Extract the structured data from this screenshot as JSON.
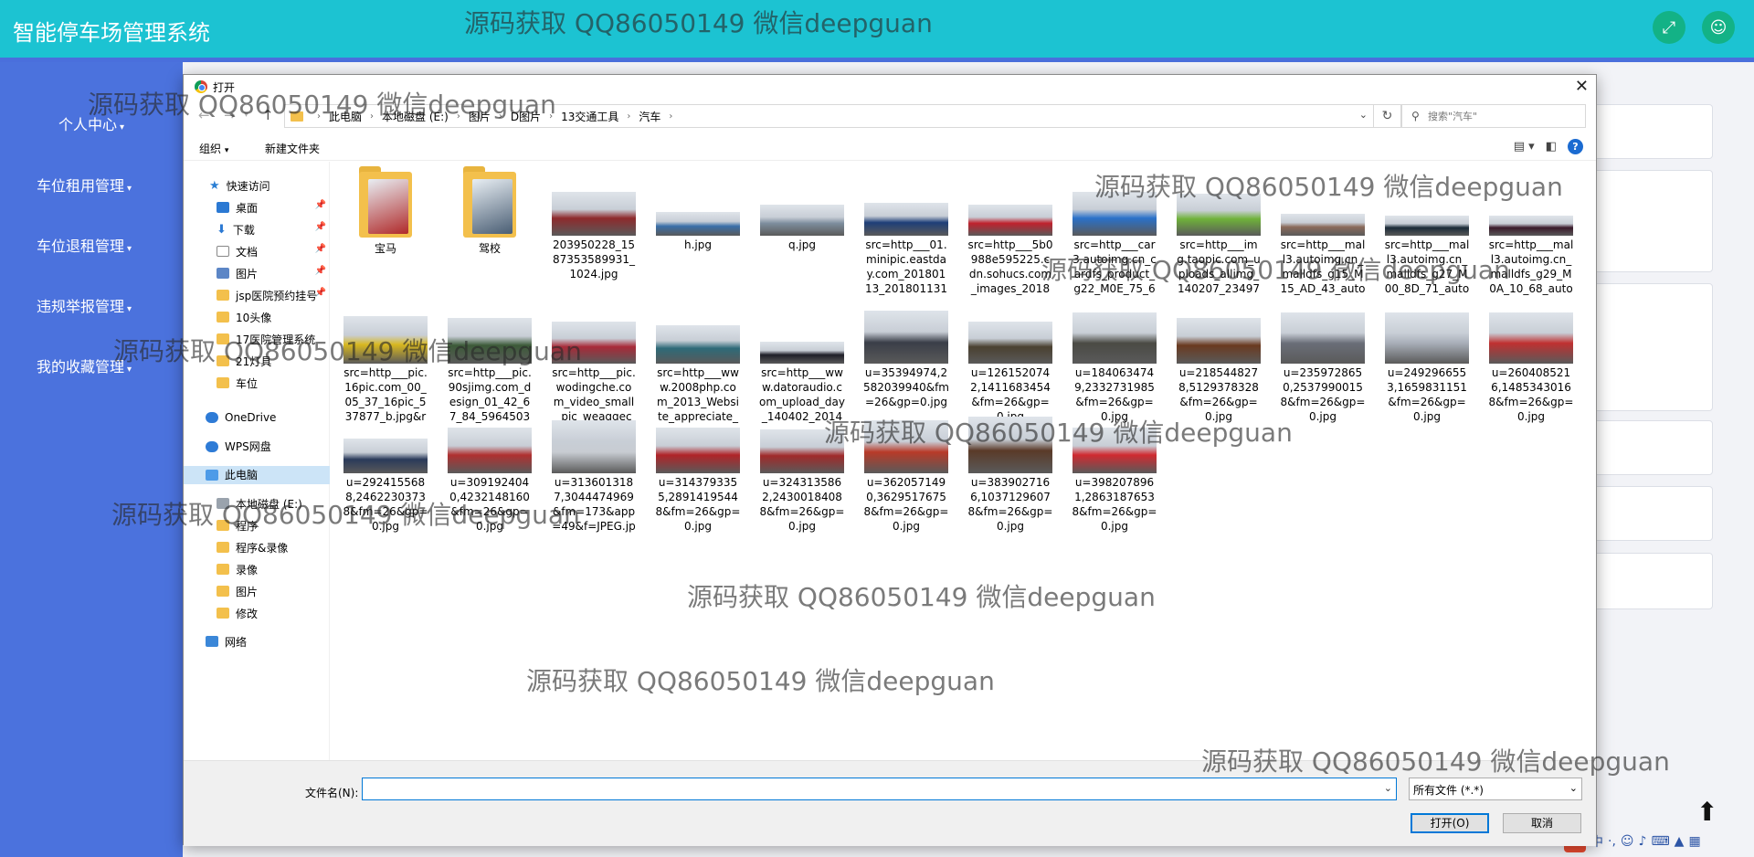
{
  "app": {
    "title": "智能停车场管理系统"
  },
  "header_icons": [
    "fullscreen-icon",
    "user-icon"
  ],
  "sidebar": {
    "items": [
      {
        "label": "个人中心"
      },
      {
        "label": "车位租用管理"
      },
      {
        "label": "车位退租管理"
      },
      {
        "label": "违规举报管理"
      },
      {
        "label": "我的收藏管理"
      }
    ]
  },
  "dialog": {
    "title": "打开",
    "path": [
      "此电脑",
      "本地磁盘 (E:)",
      "图片",
      "D图片",
      "13交通工具",
      "汽车"
    ],
    "search_placeholder": "搜索\"汽车\"",
    "toolbar": {
      "organize": "组织",
      "new_folder": "新建文件夹"
    },
    "nav_tree": [
      {
        "label": "快速访问",
        "icon": "star",
        "pinned": false
      },
      {
        "label": "桌面",
        "icon": "desk",
        "pinned": true
      },
      {
        "label": "下载",
        "icon": "down",
        "pinned": true
      },
      {
        "label": "文档",
        "icon": "doc",
        "pinned": true
      },
      {
        "label": "图片",
        "icon": "pic",
        "pinned": true
      },
      {
        "label": "jsp医院预约挂号",
        "icon": "folder",
        "pinned": true
      },
      {
        "label": "10头像",
        "icon": "folder",
        "pinned": false
      },
      {
        "label": "17医院管理系统",
        "icon": "folder",
        "pinned": false
      },
      {
        "label": "21灯具",
        "icon": "folder",
        "pinned": false
      },
      {
        "label": "车位",
        "icon": "folder",
        "pinned": false
      },
      {
        "label": "OneDrive",
        "icon": "cloud",
        "pinned": false
      },
      {
        "label": "WPS网盘",
        "icon": "cloud",
        "pinned": false
      },
      {
        "label": "此电脑",
        "icon": "pc",
        "pinned": false,
        "selected": true
      },
      {
        "label": "本地磁盘 (E:)",
        "icon": "disk",
        "pinned": false
      },
      {
        "label": "程序",
        "icon": "folder",
        "pinned": false
      },
      {
        "label": "程序&录像",
        "icon": "folder",
        "pinned": false
      },
      {
        "label": "录像",
        "icon": "folder",
        "pinned": false
      },
      {
        "label": "图片",
        "icon": "folder",
        "pinned": false
      },
      {
        "label": "修改",
        "icon": "folder",
        "pinned": false
      },
      {
        "label": "网络",
        "icon": "net",
        "pinned": false
      }
    ],
    "files": [
      {
        "name": "宝马",
        "kind": "folder",
        "color": "#b02a2a"
      },
      {
        "name": "驾校",
        "kind": "folder",
        "color": "#4a5e74"
      },
      {
        "name": "203950228_1587353589931_1024.jpg",
        "kind": "image",
        "color": "#8e2a2c"
      },
      {
        "name": "h.jpg",
        "kind": "image",
        "color": "#3a6fa8"
      },
      {
        "name": "q.jpg",
        "kind": "image",
        "color": "#7d8e9e"
      },
      {
        "name": "src=http___01.minipic.eastday.com_20180113_20180113113737...",
        "kind": "image",
        "color": "#1e3e78"
      },
      {
        "name": "src=http___5b0988e595225.cdn.sohucs.com_images_20181...",
        "kind": "image",
        "color": "#c0212d"
      },
      {
        "name": "src=http___car3.autoimg.cn_cardfs_product_g22_M0E_75_64_...",
        "kind": "image",
        "color": "#2a71c9"
      },
      {
        "name": "src=http___img.taopic.com_uploads_allimg_140207_234973-...",
        "kind": "image",
        "color": "#6fb23a"
      },
      {
        "name": "src=http___mall3.autoimg.cn_malldfs_g15_M15_AD_43_autoh...",
        "kind": "image",
        "color": "#8a6a5a"
      },
      {
        "name": "src=http___mall3.autoimg.cn_malldfs_g27_M00_8D_71_autoh...",
        "kind": "image",
        "color": "#1b2b38"
      },
      {
        "name": "src=http___mall3.autoimg.cn_malldfs_g29_M0A_10_68_autoh...",
        "kind": "image",
        "color": "#3a1a2a"
      },
      {
        "name": "src=http___pic.16pic.com_00_05_37_16pic_537877_b.jpg&refe...",
        "kind": "image",
        "color": "#d8b820"
      },
      {
        "name": "src=http___pic.90sjimg.com_design_01_42_67_84_5964503134...",
        "kind": "image",
        "color": "#3c5a38"
      },
      {
        "name": "src=http___pic.wodingche.com_video_small_pic_weaqqecx.j...",
        "kind": "image",
        "color": "#a82a38"
      },
      {
        "name": "src=http___www.2008php.com_2013_Website_appreciate_201...",
        "kind": "image",
        "color": "#2e6a78"
      },
      {
        "name": "src=http___www.datoraudio.com_upload_day_140402_20140...",
        "kind": "image",
        "color": "#1e1e28"
      },
      {
        "name": "u=35394974,2582039940&fm=26&gp=0.jpg",
        "kind": "image",
        "color": "#3a3e48"
      },
      {
        "name": "u=1261520742,1411683454&fm=26&gp=0.jpg",
        "kind": "image",
        "color": "#4a4030"
      },
      {
        "name": "u=1840634749,2332731985&fm=26&gp=0.jpg",
        "kind": "image",
        "color": "#4a4a44"
      },
      {
        "name": "u=2185448278,5129378328&fm=26&gp=0.jpg",
        "kind": "image",
        "color": "#6a3a20"
      },
      {
        "name": "u=2359728650,25379900158&fm=26&gp=0.jpg",
        "kind": "image",
        "color": "#6a6e78"
      },
      {
        "name": "u=2492966553,1659831151&fm=26&gp=0.jpg",
        "kind": "image",
        "color": "#a8aeb8"
      },
      {
        "name": "u=2604085216,14853430168&fm=26&gp=0.jpg",
        "kind": "image",
        "color": "#c03030"
      },
      {
        "name": "u=2924155688,24622303738&fm=26&gp=0.jpg",
        "kind": "image",
        "color": "#2a3a5a"
      },
      {
        "name": "u=3091924040,4232148160&fm=26&gp=0.jpg",
        "kind": "image",
        "color": "#b03030"
      },
      {
        "name": "u=3136013187,3044474969&fm=173&app=49&f=JPEG.jpg",
        "kind": "image",
        "color": "#c8ccd2"
      },
      {
        "name": "u=3143793355,28914195448&fm=26&gp=0.jpg",
        "kind": "image",
        "color": "#b02428"
      },
      {
        "name": "u=3243135862,24300184088&fm=26&gp=0.jpg",
        "kind": "image",
        "color": "#a02a2a"
      },
      {
        "name": "u=3620571490,36295176758&fm=26&gp=0.jpg",
        "kind": "image",
        "color": "#b83a28"
      },
      {
        "name": "u=3839027166,10371296078&fm=26&gp=0.jpg",
        "kind": "image",
        "color": "#5a3a28"
      },
      {
        "name": "u=3982078961,28631876538&fm=26&gp=0.jpg",
        "kind": "image",
        "color": "#d02a30"
      }
    ],
    "filename_label": "文件名(N):",
    "filename_value": "",
    "file_type": "所有文件 (*.*)",
    "open_button": "打开(O)",
    "cancel_button": "取消"
  },
  "watermarks": [
    "源码获取 QQ86050149 微信deepguan",
    "源码获取 QQ86050149 微信deepguan",
    "源码获取 QQ86050149 微信deepguan",
    "源码获取 QQ86050149 微信deepguan",
    "源码获取 QQ86050149 微信deepguan",
    "源码获取 QQ86050149 微信deepguan",
    "源码获取 QQ86050149 微信deepguan",
    "源码获取 QQ86050149 微信deepguan",
    "源码获取 QQ86050149 微信deepguan",
    "源码获取 QQ86050149 微信deepguan"
  ],
  "ime": {
    "text": "中"
  },
  "colors": {
    "header": "#1cc3d2",
    "sidebar": "#4b72dd",
    "header_button": "#13b286"
  }
}
